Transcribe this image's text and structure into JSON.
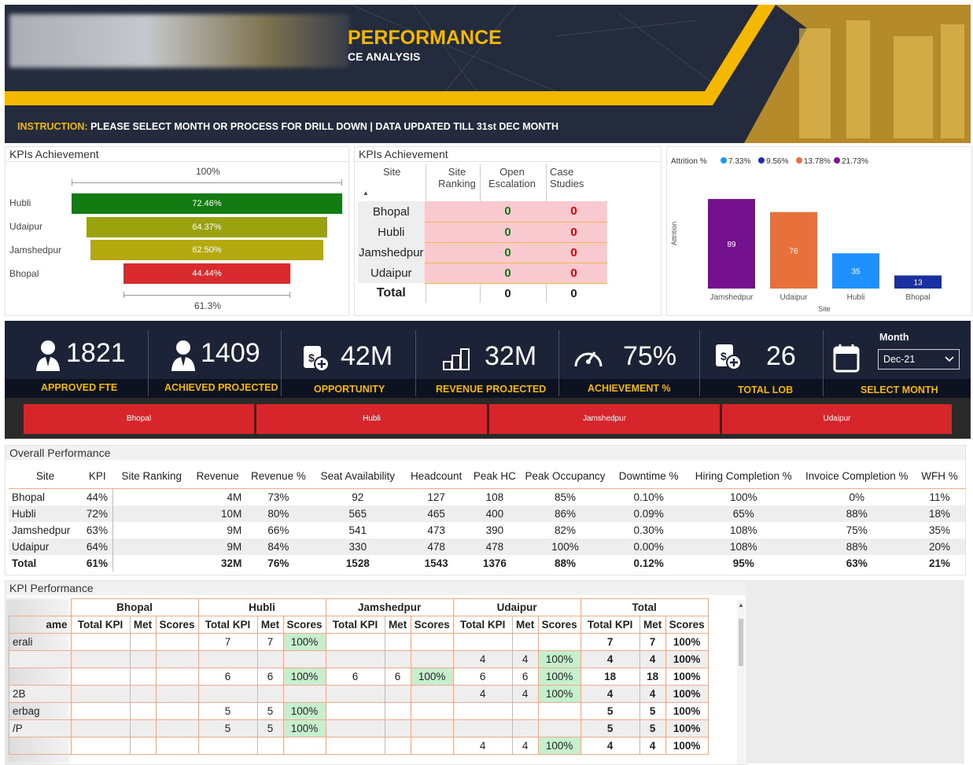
{
  "header": {
    "title": "PERFORMANCE",
    "subtitle": "CE ANALYSIS",
    "instruction_label": "INSTRUCTION:",
    "instruction_text": "PLEASE SELECT MONTH OR PROCESS FOR DRILL DOWN | DATA UPDATED TILL 31st DEC MONTH"
  },
  "funnel": {
    "title": "KPIs Achievement",
    "top_label": "100%",
    "bottom_label": "61.3%",
    "items": [
      {
        "site": "Hubli",
        "value": "72.46%",
        "color": "#127c12"
      },
      {
        "site": "Udaipur",
        "value": "64.37%",
        "color": "#9aa20e"
      },
      {
        "site": "Jamshedpur",
        "value": "62.50%",
        "color": "#b4aa10"
      },
      {
        "site": "Bhopal",
        "value": "44.44%",
        "color": "#d92b2f"
      }
    ]
  },
  "kpi_table": {
    "title": "KPIs Achievement",
    "headers": [
      "Site",
      "Site Ranking",
      "Open Escalation",
      "Case Studies"
    ],
    "rows": [
      {
        "site": "Bhopal",
        "oe": "0",
        "cs": "0"
      },
      {
        "site": "Hubli",
        "oe": "0",
        "cs": "0"
      },
      {
        "site": "Jamshedpur",
        "oe": "0",
        "cs": "0"
      },
      {
        "site": "Udaipur",
        "oe": "0",
        "cs": "0"
      }
    ],
    "total": {
      "site": "Total",
      "oe": "0",
      "cs": "0"
    }
  },
  "chart_data": {
    "type": "bar",
    "title": "Attrition %",
    "legend": [
      "7.33%",
      "9.56%",
      "13.78%",
      "21.73%"
    ],
    "legend_colors": [
      "#2196f3",
      "#1a2fa0",
      "#e8703a",
      "#7a1a8e"
    ],
    "categories": [
      "Jamshedpur",
      "Udaipur",
      "Hubli",
      "Bhopal"
    ],
    "values": [
      89,
      76,
      35,
      13
    ],
    "colors": [
      "#74118e",
      "#e8703a",
      "#1e90ff",
      "#1a2fa0"
    ],
    "xlabel": "Site",
    "ylabel": "Attrition",
    "ylim": [
      0,
      100
    ]
  },
  "kpis": [
    {
      "value": "1821",
      "label": "APPROVED FTE",
      "icon": "person-icon"
    },
    {
      "value": "1409",
      "label": "ACHIEVED PROJECTED",
      "icon": "person-icon"
    },
    {
      "value": "42M",
      "label": "OPPORTUNITY",
      "icon": "dollar-doc-icon"
    },
    {
      "value": "32M",
      "label": "REVENUE PROJECTED",
      "icon": "coins-icon"
    },
    {
      "value": "75%",
      "label": "ACHIEVEMENT %",
      "icon": "gauge-icon"
    },
    {
      "value": "26",
      "label": "TOTAL LOB",
      "icon": "dollar-doc-icon"
    }
  ],
  "month": {
    "label": "Month",
    "value": "Dec-21",
    "caption": "SELECT MONTH"
  },
  "sites": [
    "Bhopal",
    "Hubli",
    "Jamshedpur",
    "Udaipur"
  ],
  "overall": {
    "title": "Overall Performance",
    "headers": [
      "Site",
      "KPI",
      "Site Ranking",
      "Revenue",
      "Revenue %",
      "Seat Availability",
      "Headcount",
      "Peak HC",
      "Peak Occupancy",
      "Downtime %",
      "Hiring Completion %",
      "Invoice Completion %",
      "WFH %"
    ],
    "rows": [
      [
        "Bhopal",
        "44%",
        "",
        "4M",
        "73%",
        "92",
        "127",
        "108",
        "85%",
        "0.10%",
        "100%",
        "0%",
        "11%"
      ],
      [
        "Hubli",
        "72%",
        "",
        "10M",
        "80%",
        "565",
        "465",
        "400",
        "86%",
        "0.09%",
        "65%",
        "88%",
        "18%"
      ],
      [
        "Jamshedpur",
        "63%",
        "",
        "9M",
        "66%",
        "541",
        "473",
        "390",
        "82%",
        "0.30%",
        "108%",
        "75%",
        "35%"
      ],
      [
        "Udaipur",
        "64%",
        "",
        "9M",
        "84%",
        "330",
        "478",
        "478",
        "100%",
        "0.00%",
        "108%",
        "88%",
        "20%"
      ]
    ],
    "total": [
      "Total",
      "61%",
      "",
      "32M",
      "76%",
      "1528",
      "1543",
      "1376",
      "88%",
      "0.12%",
      "95%",
      "63%",
      "21%"
    ]
  },
  "kpi_perf": {
    "title": "KPI Performance",
    "groups": [
      "Bhopal",
      "Hubli",
      "Jamshedpur",
      "Udaipur",
      "Total"
    ],
    "sub": [
      "Total KPI",
      "Met",
      "Scores"
    ],
    "name_header": "ame",
    "rows": [
      [
        "erali",
        "",
        "",
        "",
        "7",
        "7",
        "100%",
        "",
        "",
        "",
        "",
        "",
        "",
        "7",
        "7",
        "100%"
      ],
      [
        "",
        "",
        "",
        "",
        "",
        "",
        "",
        "",
        "",
        "",
        "4",
        "4",
        "100%",
        "4",
        "4",
        "100%"
      ],
      [
        "",
        "",
        "",
        "",
        "6",
        "6",
        "100%",
        "6",
        "6",
        "100%",
        "6",
        "6",
        "100%",
        "18",
        "18",
        "100%"
      ],
      [
        "2B",
        "",
        "",
        "",
        "",
        "",
        "",
        "",
        "",
        "",
        "4",
        "4",
        "100%",
        "4",
        "4",
        "100%"
      ],
      [
        "erbag",
        "",
        "",
        "",
        "5",
        "5",
        "100%",
        "",
        "",
        "",
        "",
        "",
        "",
        "5",
        "5",
        "100%"
      ],
      [
        "/P",
        "",
        "",
        "",
        "5",
        "5",
        "100%",
        "",
        "",
        "",
        "",
        "",
        "",
        "5",
        "5",
        "100%"
      ],
      [
        "",
        "",
        "",
        "",
        "",
        "",
        "",
        "",
        "",
        "",
        "4",
        "4",
        "100%",
        "4",
        "4",
        "100%"
      ]
    ]
  }
}
